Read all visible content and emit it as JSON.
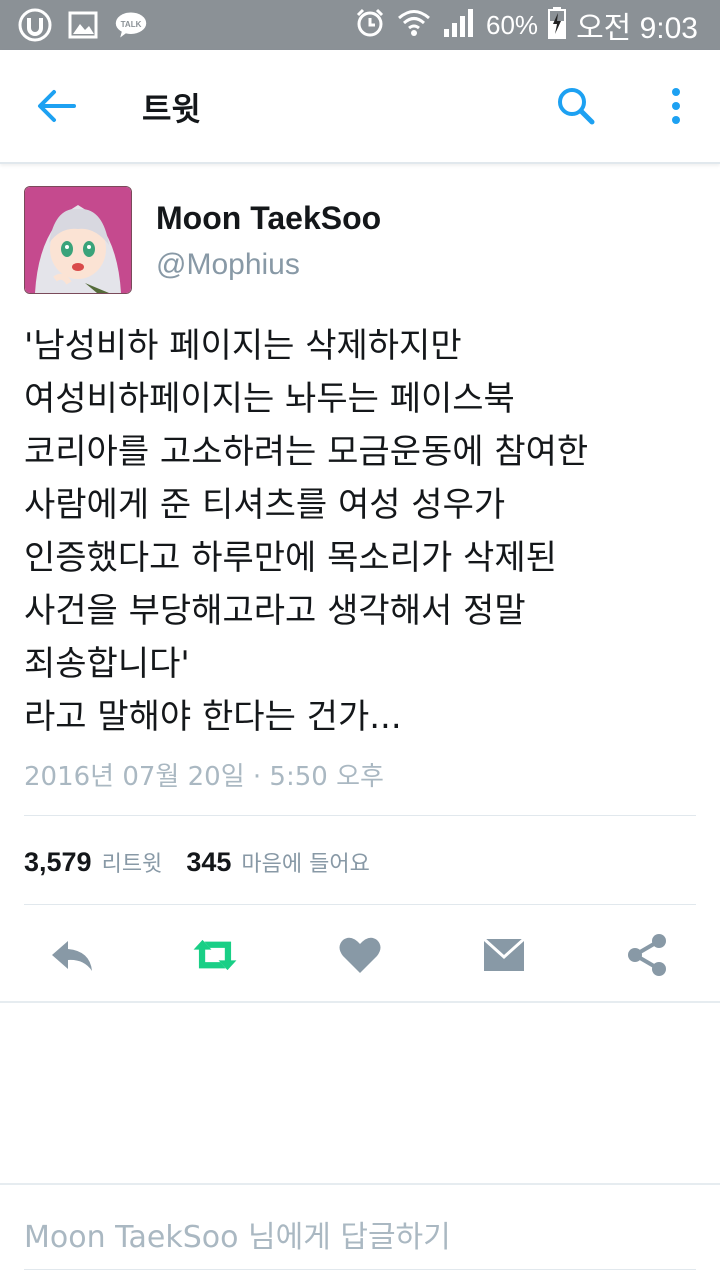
{
  "status_bar": {
    "left_icons": [
      "u-plus-icon",
      "image-icon",
      "kakaotalk-icon"
    ],
    "talk_badge": "TALK",
    "battery_percent_text": "60%",
    "time": "오전 9:03",
    "colors": {
      "background": "#8b9196"
    }
  },
  "appbar": {
    "title": "트윗",
    "accent_color": "#1da1f2"
  },
  "tweet": {
    "author_name": "Moon TaekSoo",
    "author_handle": "@Mophius",
    "lines": [
      "'남성비하 페이지는 삭제하지만",
      "여성비하페이지는 놔두는 페이스북",
      "코리아를 고소하려는 모금운동에 참여한",
      "사람에게 준 티셔츠를 여성 성우가",
      "인증했다고 하루만에 목소리가 삭제된",
      "사건을 부당해고라고 생각해서 정말",
      "죄송합니다'",
      "라고 말해야 한다는 건가..."
    ],
    "timestamp": "2016년 07월 20일 · 5:50 오후",
    "retweet_count": "3,579",
    "retweet_label": "리트윗",
    "like_count": "345",
    "like_label": "마음에 들어요"
  },
  "actions": {
    "reply": "reply-icon",
    "retweet": "retweet-icon",
    "like": "heart-icon",
    "dm": "envelope-icon",
    "share": "share-icon",
    "retweet_active_color": "#19cf86",
    "default_color": "#8899a6"
  },
  "reply_bar": {
    "placeholder": "Moon TaekSoo 님에게 답글하기"
  }
}
